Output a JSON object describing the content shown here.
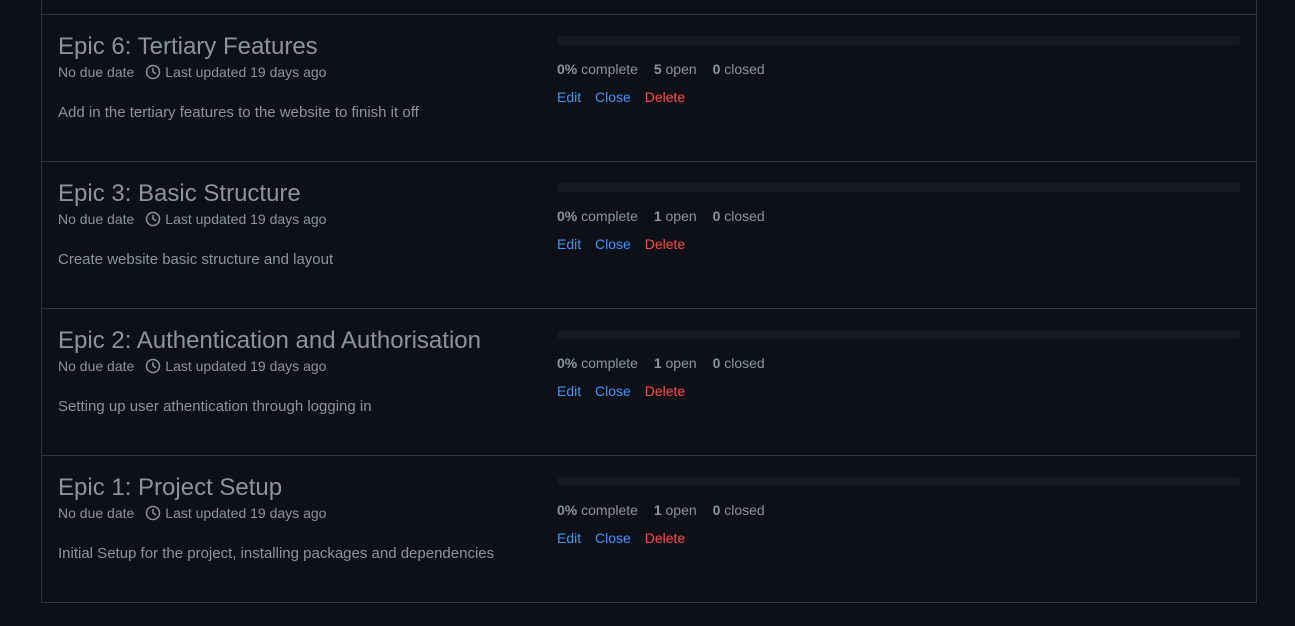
{
  "colors": {
    "background": "#0d1117",
    "border": "#30363d",
    "text_muted": "#8b949e",
    "link": "#4493f8",
    "danger": "#f85149",
    "progress_track": "#161b22"
  },
  "milestones": [
    {
      "title": "Epic 6: Tertiary Features",
      "due": "No due date",
      "updated": "Last updated 19 days ago",
      "description": "Add in the tertiary features to the website to finish it off",
      "percent": "0%",
      "percent_label": "complete",
      "open_count": "5",
      "open_label": "open",
      "closed_count": "0",
      "closed_label": "closed",
      "progress_fraction": 0,
      "edit_label": "Edit",
      "close_label": "Close",
      "delete_label": "Delete"
    },
    {
      "title": "Epic 3: Basic Structure",
      "due": "No due date",
      "updated": "Last updated 19 days ago",
      "description": "Create website basic structure and layout",
      "percent": "0%",
      "percent_label": "complete",
      "open_count": "1",
      "open_label": "open",
      "closed_count": "0",
      "closed_label": "closed",
      "progress_fraction": 0,
      "edit_label": "Edit",
      "close_label": "Close",
      "delete_label": "Delete"
    },
    {
      "title": "Epic 2: Authentication and Authorisation",
      "due": "No due date",
      "updated": "Last updated 19 days ago",
      "description": "Setting up user athentication through logging in",
      "percent": "0%",
      "percent_label": "complete",
      "open_count": "1",
      "open_label": "open",
      "closed_count": "0",
      "closed_label": "closed",
      "progress_fraction": 0,
      "edit_label": "Edit",
      "close_label": "Close",
      "delete_label": "Delete"
    },
    {
      "title": "Epic 1: Project Setup",
      "due": "No due date",
      "updated": "Last updated 19 days ago",
      "description": "Initial Setup for the project, installing packages and dependencies",
      "percent": "0%",
      "percent_label": "complete",
      "open_count": "1",
      "open_label": "open",
      "closed_count": "0",
      "closed_label": "closed",
      "progress_fraction": 0,
      "edit_label": "Edit",
      "close_label": "Close",
      "delete_label": "Delete"
    }
  ]
}
